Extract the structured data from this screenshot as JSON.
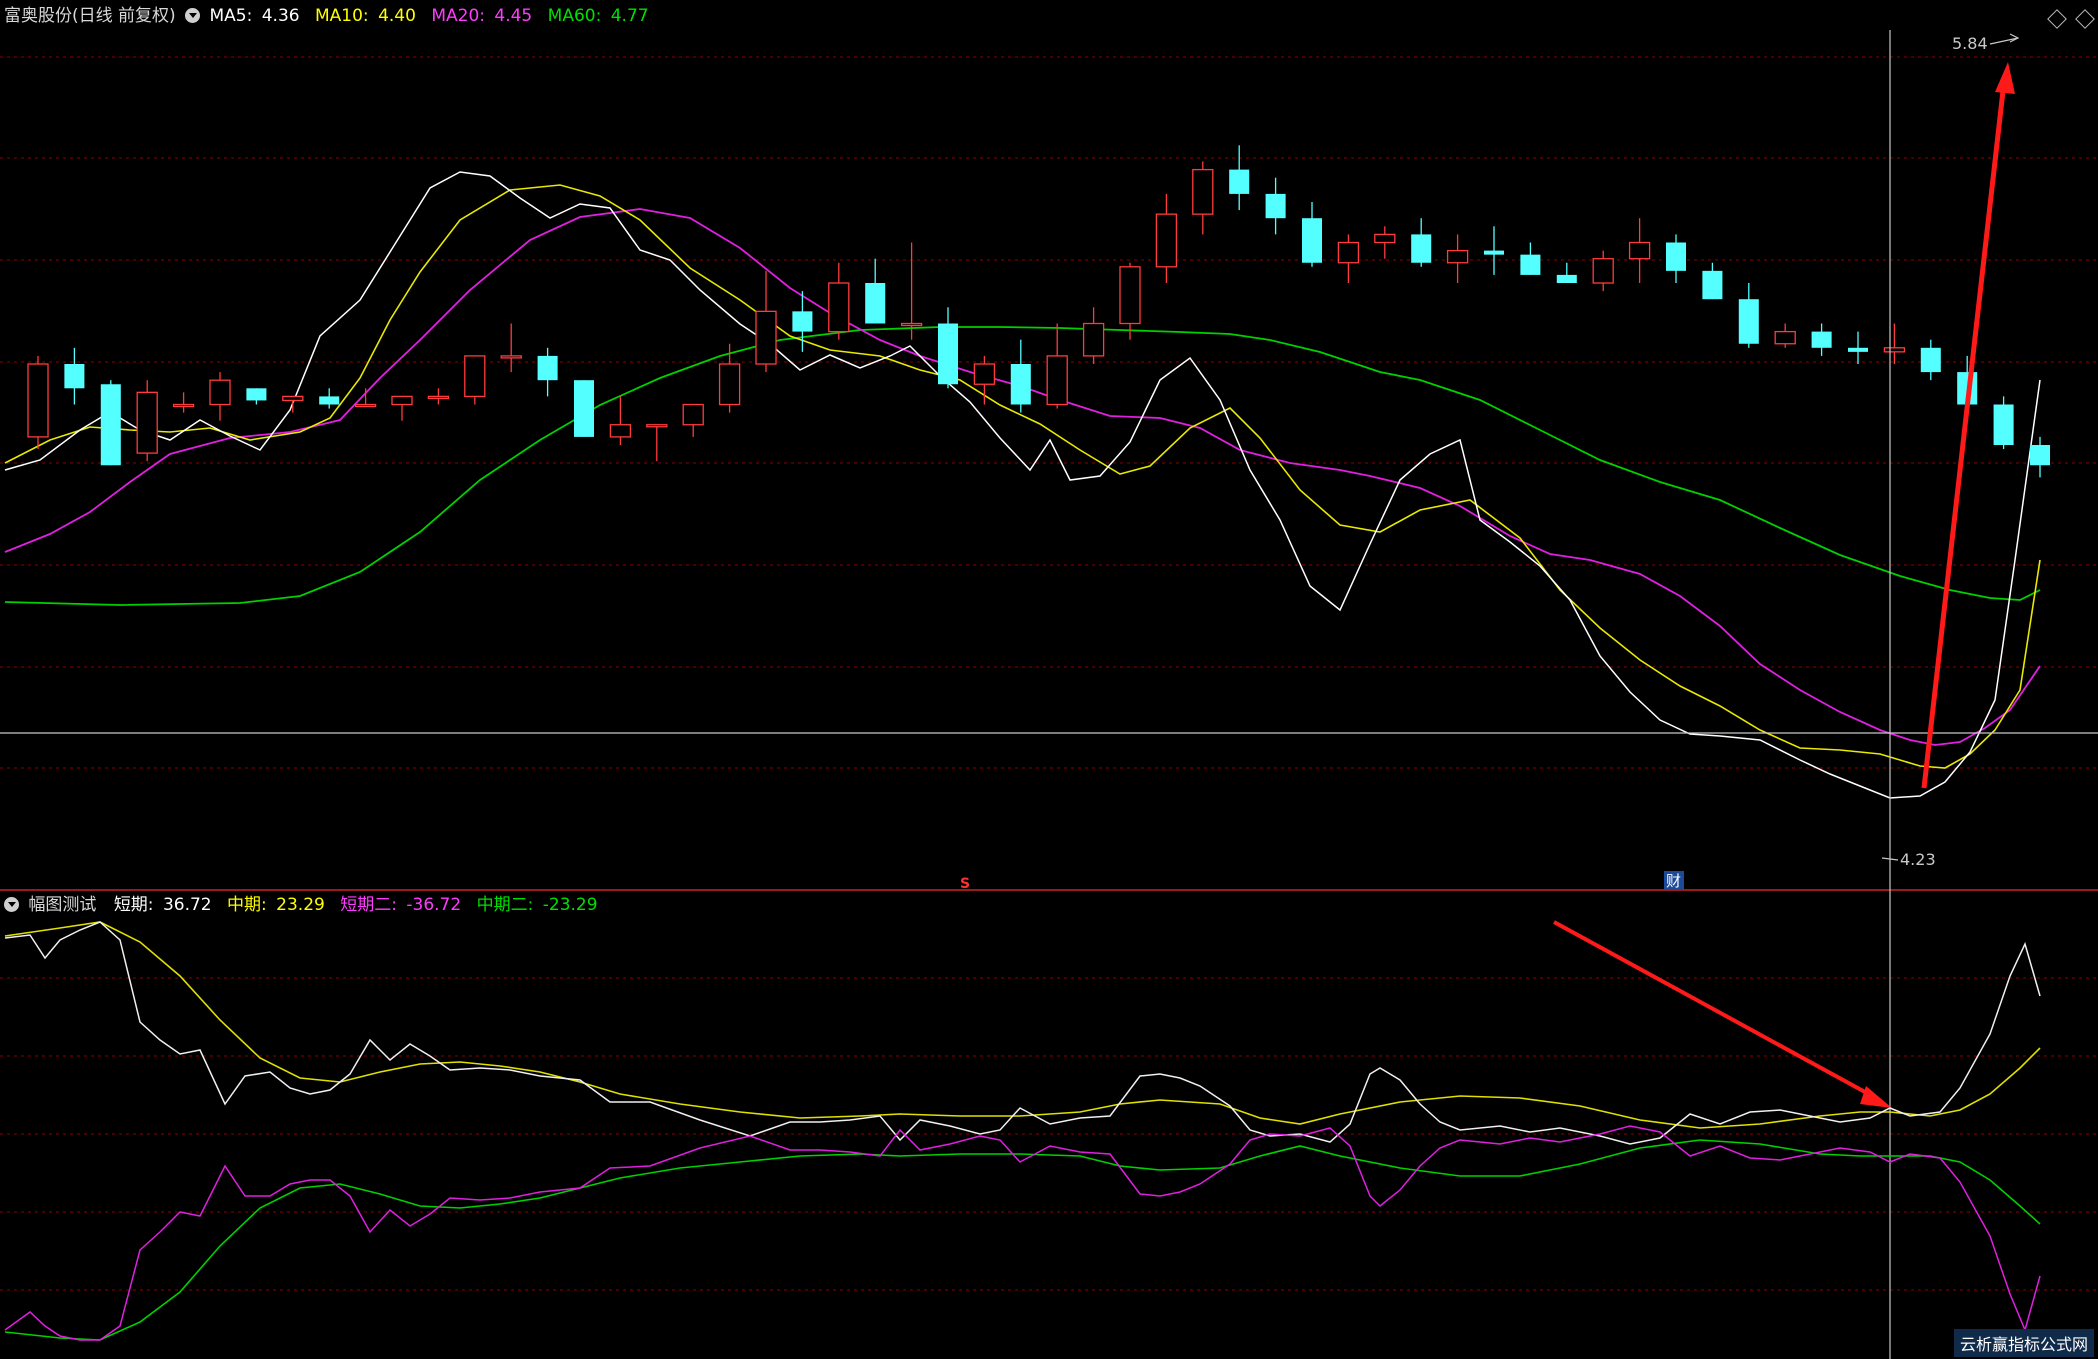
{
  "header": {
    "stock_title": "富奥股份(日线 前复权)",
    "ma5_label": "MA5:",
    "ma5_value": "4.36",
    "ma10_label": "MA10:",
    "ma10_value": "4.40",
    "ma20_label": "MA20:",
    "ma20_value": "4.45",
    "ma60_label": "MA60:",
    "ma60_value": "4.77"
  },
  "indicator": {
    "title": "幅图测试",
    "short_label": "短期:",
    "short_value": "36.72",
    "mid_label": "中期:",
    "mid_value": "23.29",
    "short2_label": "短期二:",
    "short2_value": "-36.72",
    "mid2_label": "中期二:",
    "mid2_value": "-23.29"
  },
  "markers": {
    "high_label": "5.84",
    "low_label": "4.23",
    "s_marker": "S",
    "cai_marker": "财"
  },
  "watermark": "云析赢指标公式网",
  "colors": {
    "background": "#000000",
    "up_candle": "#ff3b3b",
    "down_candle": "#54ffff",
    "ma5": "#ffffff",
    "ma10": "#ffff00",
    "ma20": "#ff3bff",
    "ma60": "#00e000",
    "grid": "#8b0000",
    "arrow": "#ff2020"
  },
  "chart_data": [
    {
      "type": "candlestick",
      "title": "富奥股份(日线 前复权)",
      "price_range": [
        4.0,
        6.0
      ],
      "price_high": 5.84,
      "price_low": 4.23,
      "candles_ohlc": [
        [
          5.02,
          5.22,
          4.99,
          5.2
        ],
        [
          5.2,
          5.24,
          5.1,
          5.14
        ],
        [
          5.15,
          5.16,
          4.95,
          4.95
        ],
        [
          4.98,
          5.16,
          4.96,
          5.13
        ],
        [
          5.1,
          5.13,
          5.08,
          5.1
        ],
        [
          5.1,
          5.18,
          5.06,
          5.16
        ],
        [
          5.14,
          5.14,
          5.1,
          5.11
        ],
        [
          5.11,
          5.12,
          5.08,
          5.12
        ],
        [
          5.12,
          5.14,
          5.09,
          5.1
        ],
        [
          5.1,
          5.14,
          5.1,
          5.1
        ],
        [
          5.1,
          5.12,
          5.06,
          5.12
        ],
        [
          5.12,
          5.14,
          5.1,
          5.12
        ],
        [
          5.12,
          5.22,
          5.1,
          5.22
        ],
        [
          5.22,
          5.3,
          5.18,
          5.22
        ],
        [
          5.22,
          5.24,
          5.12,
          5.16
        ],
        [
          5.16,
          5.16,
          5.02,
          5.02
        ],
        [
          5.02,
          5.12,
          5.0,
          5.05
        ],
        [
          5.05,
          5.05,
          4.96,
          5.05
        ],
        [
          5.05,
          5.1,
          5.02,
          5.1
        ],
        [
          5.1,
          5.25,
          5.08,
          5.2
        ],
        [
          5.2,
          5.43,
          5.18,
          5.33
        ],
        [
          5.33,
          5.38,
          5.23,
          5.28
        ],
        [
          5.28,
          5.45,
          5.26,
          5.4
        ],
        [
          5.4,
          5.46,
          5.3,
          5.3
        ],
        [
          5.3,
          5.5,
          5.26,
          5.3
        ],
        [
          5.3,
          5.34,
          5.14,
          5.15
        ],
        [
          5.15,
          5.22,
          5.1,
          5.2
        ],
        [
          5.2,
          5.26,
          5.08,
          5.1
        ],
        [
          5.1,
          5.3,
          5.09,
          5.22
        ],
        [
          5.22,
          5.34,
          5.2,
          5.3
        ],
        [
          5.3,
          5.45,
          5.26,
          5.44
        ],
        [
          5.44,
          5.62,
          5.4,
          5.57
        ],
        [
          5.57,
          5.7,
          5.52,
          5.68
        ],
        [
          5.68,
          5.74,
          5.58,
          5.62
        ],
        [
          5.62,
          5.66,
          5.52,
          5.56
        ],
        [
          5.56,
          5.6,
          5.44,
          5.45
        ],
        [
          5.45,
          5.52,
          5.4,
          5.5
        ],
        [
          5.5,
          5.54,
          5.46,
          5.52
        ],
        [
          5.52,
          5.56,
          5.44,
          5.45
        ],
        [
          5.45,
          5.52,
          5.4,
          5.48
        ],
        [
          5.48,
          5.54,
          5.42,
          5.47
        ],
        [
          5.47,
          5.5,
          5.42,
          5.42
        ],
        [
          5.42,
          5.45,
          5.4,
          5.4
        ],
        [
          5.4,
          5.48,
          5.38,
          5.46
        ],
        [
          5.46,
          5.56,
          5.4,
          5.5
        ],
        [
          5.5,
          5.52,
          5.4,
          5.43
        ],
        [
          5.43,
          5.45,
          5.36,
          5.36
        ],
        [
          5.36,
          5.4,
          5.24,
          5.25
        ],
        [
          5.25,
          5.3,
          5.24,
          5.28
        ],
        [
          5.28,
          5.3,
          5.22,
          5.24
        ],
        [
          5.24,
          5.28,
          5.2,
          5.23
        ],
        [
          5.23,
          5.3,
          5.2,
          5.24
        ],
        [
          5.24,
          5.26,
          5.16,
          5.18
        ],
        [
          5.18,
          5.22,
          5.1,
          5.1
        ],
        [
          5.1,
          5.12,
          4.99,
          5.0
        ],
        [
          5.0,
          5.02,
          4.92,
          4.95
        ]
      ]
    },
    {
      "type": "line",
      "title": "幅图测试",
      "ylim": [
        -45,
        45
      ],
      "series": [
        {
          "name": "短期",
          "last": 36.72
        },
        {
          "name": "中期",
          "last": 23.29
        },
        {
          "name": "短期二",
          "last": -36.72
        },
        {
          "name": "中期二",
          "last": -23.29
        }
      ]
    }
  ]
}
